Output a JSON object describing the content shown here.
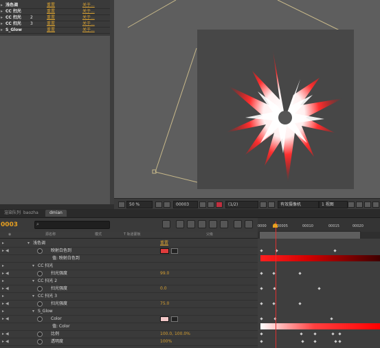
{
  "effects_list": [
    {
      "name": "浅色调",
      "num": "",
      "reset": "重置",
      "about": "关于..."
    },
    {
      "name": "CC 扫光",
      "num": "",
      "reset": "重置",
      "about": "关于..."
    },
    {
      "name": "CC 扫光",
      "num": "2",
      "reset": "重置",
      "about": "关于..."
    },
    {
      "name": "CC 扫光",
      "num": "3",
      "reset": "重置",
      "about": "关于..."
    },
    {
      "name": "S_Glow",
      "num": "",
      "reset": "重置",
      "about": "关于..."
    }
  ],
  "viewer_bar": {
    "zoom": "50 %",
    "timecode": "00003",
    "resolution": "(1/2)",
    "camera": "有效摄像机",
    "views": "1 视图"
  },
  "timeline": {
    "tabs": [
      "渲染队列",
      "baozha",
      "dmian"
    ],
    "active_tab": "dmian",
    "timecode": "0003",
    "column_headers": {
      "name": "源名称",
      "mode": "模式",
      "trkmat": "T 轨道蒙板",
      "parent": "父级"
    },
    "ruler_ticks": [
      "0000",
      "00005",
      "00010",
      "00015",
      "00020"
    ],
    "layers": [
      {
        "indent": 48,
        "type": "group",
        "label": "浅色调",
        "value": "重置",
        "is_reset": true
      },
      {
        "indent": 62,
        "type": "prop",
        "label": "映射白色到",
        "swatch": "#e03c3c"
      },
      {
        "indent": 76,
        "type": "text",
        "label": "映射白色到",
        "gradient": "linear-gradient(to right,#ff2020 0%,#d00000 40%,#400000 100%)"
      },
      {
        "indent": 55,
        "type": "group",
        "label": "CC 扫光",
        "value": ""
      },
      {
        "indent": 62,
        "type": "prop",
        "label": "扫光强度",
        "value": "99.0"
      },
      {
        "indent": 55,
        "type": "group",
        "label": "CC 扫光      2",
        "value": ""
      },
      {
        "indent": 62,
        "type": "prop",
        "label": "扫光强度",
        "value": "0.0"
      },
      {
        "indent": 55,
        "type": "group",
        "label": "CC 扫光      3",
        "value": ""
      },
      {
        "indent": 62,
        "type": "prop",
        "label": "扫光强度",
        "value": "75.0"
      },
      {
        "indent": 55,
        "type": "group",
        "label": "S_Glow",
        "value": ""
      },
      {
        "indent": 62,
        "type": "prop",
        "label": "Color",
        "swatch": "#f2c8c8"
      },
      {
        "indent": 76,
        "type": "text",
        "label": "Color",
        "gradient": "linear-gradient(to right,#ffffff 0%,#ff4040 45%,#ff0000 100%)"
      },
      {
        "indent": 62,
        "type": "prop",
        "label": "比例",
        "value": "100.0, 100.0%"
      },
      {
        "indent": 62,
        "type": "prop",
        "label": "透明度",
        "value": "100%"
      }
    ]
  },
  "colors": {
    "accent": "#e8a020",
    "playhead": "#e03030",
    "swatch_red": "#e03c3c"
  }
}
